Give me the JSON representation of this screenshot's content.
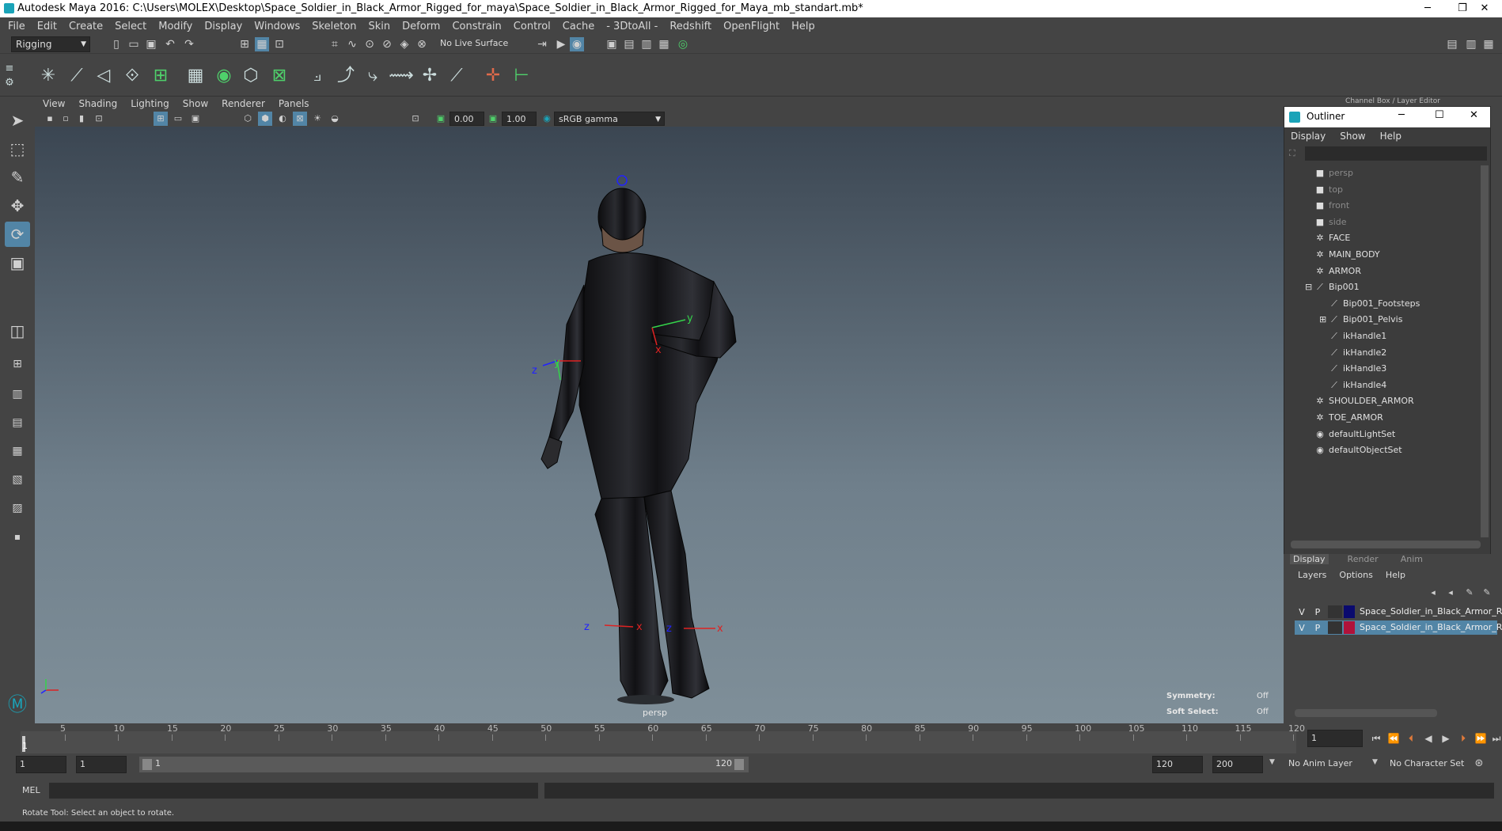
{
  "window": {
    "title": "Autodesk Maya 2016: C:\\Users\\MOLEX\\Desktop\\Space_Soldier_in_Black_Armor_Rigged_for_maya\\Space_Soldier_in_Black_Armor_Rigged_for_Maya_mb_standart.mb*"
  },
  "menubar": [
    "File",
    "Edit",
    "Create",
    "Select",
    "Modify",
    "Display",
    "Windows",
    "Skeleton",
    "Skin",
    "Deform",
    "Constrain",
    "Control",
    "Cache",
    "- 3DtoAll -",
    "Redshift",
    "OpenFlight",
    "Help"
  ],
  "statusline": {
    "mode": "Rigging",
    "live_surface": "No Live Surface"
  },
  "panel": {
    "menus": [
      "View",
      "Shading",
      "Lighting",
      "Show",
      "Renderer",
      "Panels"
    ],
    "exposure": "0.00",
    "gamma": "1.00",
    "colorspace": "sRGB gamma"
  },
  "viewport": {
    "camera_label": "persp",
    "symmetry_label": "Symmetry:",
    "symmetry_value": "Off",
    "soft_select_label": "Soft Select:",
    "soft_select_value": "Off"
  },
  "outliner": {
    "title": "Outliner",
    "menus": [
      "Display",
      "Show",
      "Help"
    ],
    "items": [
      {
        "label": "persp",
        "icon": "camera-icon",
        "dim": true
      },
      {
        "label": "top",
        "icon": "camera-icon",
        "dim": true
      },
      {
        "label": "front",
        "icon": "camera-icon",
        "dim": true
      },
      {
        "label": "side",
        "icon": "camera-icon",
        "dim": true
      },
      {
        "label": "FACE",
        "icon": "group-icon"
      },
      {
        "label": "MAIN_BODY",
        "icon": "group-icon"
      },
      {
        "label": "ARMOR",
        "icon": "group-icon"
      },
      {
        "label": "Bip001",
        "icon": "joint-icon"
      },
      {
        "label": "Bip001_Footsteps",
        "icon": "joint-icon"
      },
      {
        "label": "Bip001_Pelvis",
        "icon": "joint-icon"
      },
      {
        "label": "ikHandle1",
        "icon": "ik-handle-icon"
      },
      {
        "label": "ikHandle2",
        "icon": "ik-handle-icon"
      },
      {
        "label": "ikHandle3",
        "icon": "ik-handle-icon"
      },
      {
        "label": "ikHandle4",
        "icon": "ik-handle-icon"
      },
      {
        "label": "SHOULDER_ARMOR",
        "icon": "group-icon"
      },
      {
        "label": "TOE_ARMOR",
        "icon": "group-icon"
      },
      {
        "label": "defaultLightSet",
        "icon": "set-icon"
      },
      {
        "label": "defaultObjectSet",
        "icon": "set-icon"
      }
    ]
  },
  "channelbox": {
    "header": "Channel Box / Layer Editor",
    "tabs": [
      "Display",
      "Render",
      "Anim"
    ],
    "menus": [
      "Layers",
      "Options",
      "Help"
    ],
    "layers": [
      {
        "v": "V",
        "p": "P",
        "name": "Space_Soldier_in_Black_Armor_R",
        "color": "#0a0a6e",
        "selected": false
      },
      {
        "v": "V",
        "p": "P",
        "name": "Space_Soldier_in_Black_Armor_R",
        "color": "#b0123a",
        "selected": true
      }
    ]
  },
  "timeslider": {
    "ticks": [
      "5",
      "10",
      "15",
      "20",
      "25",
      "30",
      "35",
      "40",
      "45",
      "50",
      "55",
      "60",
      "65",
      "70",
      "75",
      "80",
      "85",
      "90",
      "95",
      "100",
      "105",
      "110",
      "115",
      "120"
    ],
    "current_frame_marker": "1",
    "current_frame": "1"
  },
  "range": {
    "start": "1",
    "playback_start": "1",
    "range_start_label": "1",
    "range_end_label": "120",
    "playback_end": "120",
    "end": "200",
    "anim_layer": "No Anim Layer",
    "character_set": "No Character Set"
  },
  "cmdline": {
    "label": "MEL"
  },
  "helpline": {
    "text": "Rotate Tool: Select an object to rotate."
  }
}
